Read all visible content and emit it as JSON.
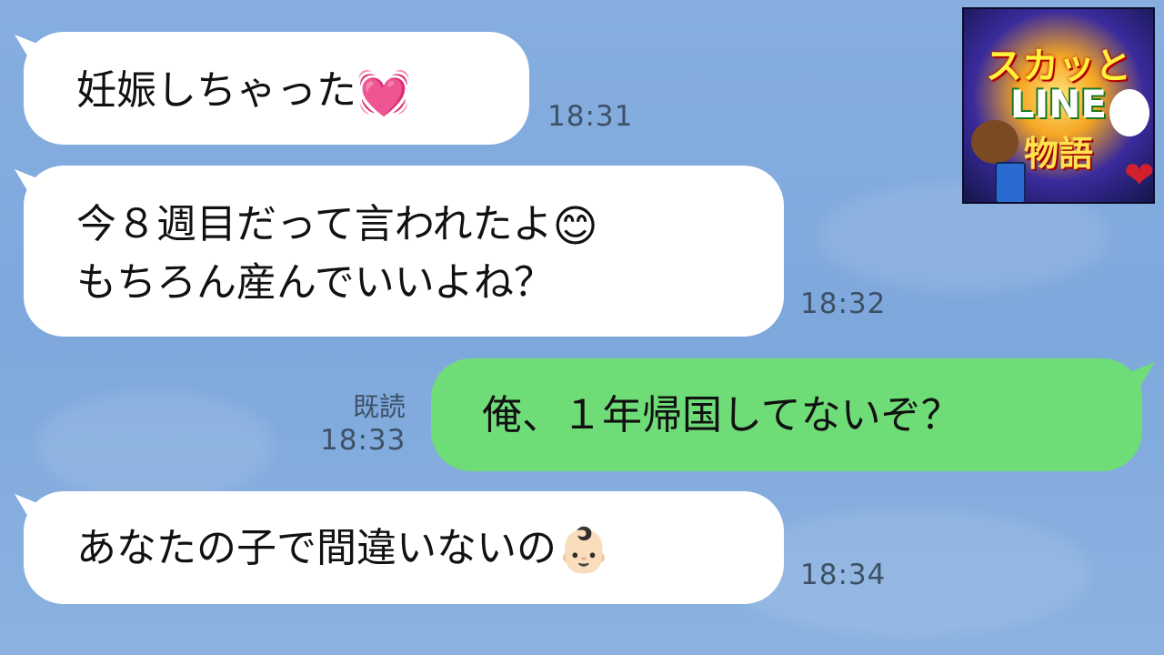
{
  "messages": [
    {
      "text": "妊娠しちゃった",
      "emoji": "💓",
      "time": "18:31"
    },
    {
      "line1": "今８週目だって言われたよ",
      "emoji": "😊",
      "line2": "もちろん産んでいいよね？",
      "time": "18:32"
    },
    {
      "text": "俺、１年帰国してないぞ？",
      "read": "既読",
      "time": "18:33"
    },
    {
      "text": "あなたの子で間違いないの",
      "emoji": "👶🏻",
      "time": "18:34"
    }
  ],
  "logo": {
    "line1": "スカッと",
    "line2": "LINE",
    "line3": "物語"
  }
}
